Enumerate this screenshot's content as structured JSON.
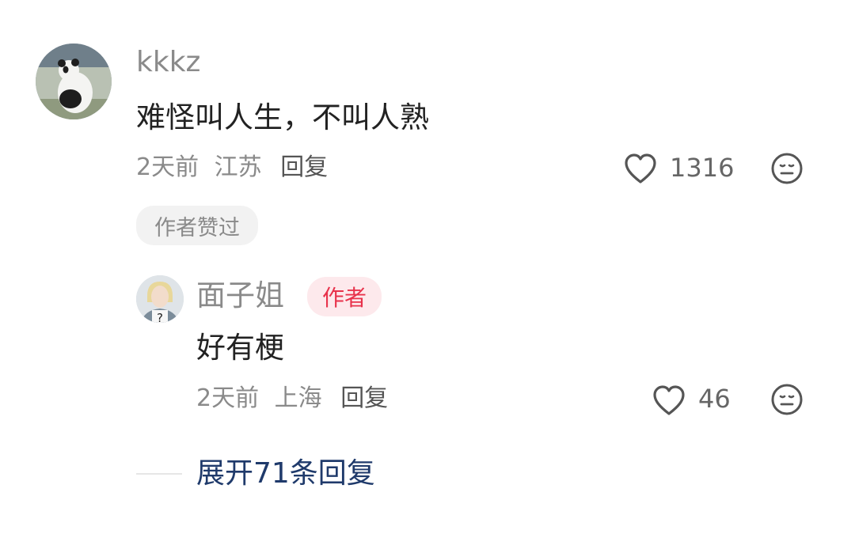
{
  "comment": {
    "username": "kkkz",
    "text": "难怪叫人生，不叫人熟",
    "time": "2天前",
    "location": "江苏",
    "reply_label": "回复",
    "like_count": "1316",
    "liked_badge": "作者赞过"
  },
  "reply": {
    "username": "面子姐",
    "author_badge": "作者",
    "text": "好有梗",
    "time": "2天前",
    "location": "上海",
    "reply_label": "回复",
    "like_count": "46"
  },
  "expand": {
    "label": "展开71条回复"
  },
  "icons": {
    "like": "heart-outline-icon",
    "reaction": "neutral-face-icon"
  }
}
